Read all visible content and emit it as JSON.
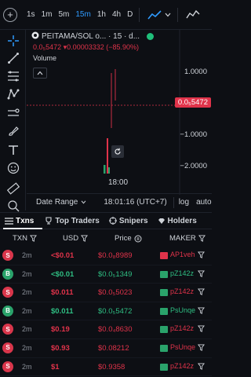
{
  "toolbar_top": {
    "timeframes": [
      "1s",
      "1m",
      "5m",
      "15m",
      "1h",
      "4h",
      "D"
    ],
    "active_timeframe": "15m"
  },
  "legend": {
    "pair_title": "PEITAMA/SOL o... · 15 · d...",
    "ohlc": "0.0₅5472 ▾0.00003332 (−85.90%)",
    "volume_label": "Volume"
  },
  "price_axis": {
    "labels": [
      "1.0000",
      "−1.0000",
      "−2.0000"
    ],
    "current_price": "0.0₅5472"
  },
  "time_axis": {
    "label": "18:00"
  },
  "date_bar": {
    "date_range_label": "Date Range",
    "clock": "18:01:16 (UTC+7)",
    "log_label": "log",
    "auto_label": "auto"
  },
  "tabs": [
    {
      "label": "Txns"
    },
    {
      "label": "Top Traders"
    },
    {
      "label": "Snipers"
    },
    {
      "label": "Holders"
    }
  ],
  "table_header": {
    "txn": "TXN",
    "usd": "USD",
    "price": "Price",
    "maker": "MAKER"
  },
  "rows": [
    {
      "side": "S",
      "age": "2m",
      "usd": "<$0.01",
      "price": "$0.0₈8989",
      "maker": "AP1veh",
      "type": "sell"
    },
    {
      "side": "B",
      "age": "2m",
      "usd": "<$0.01",
      "price": "$0.0₅1349",
      "maker": "pZ142z",
      "type": "buy"
    },
    {
      "side": "S",
      "age": "2m",
      "usd": "$0.011",
      "price": "$0.0₅5023",
      "maker": "pZ142z",
      "type": "sell"
    },
    {
      "side": "B",
      "age": "2m",
      "usd": "$0.011",
      "price": "$0.0₅5472",
      "maker": "PsUnqe",
      "type": "buy"
    },
    {
      "side": "S",
      "age": "2m",
      "usd": "$0.19",
      "price": "$0.0₄8630",
      "maker": "pZ142z",
      "type": "sell"
    },
    {
      "side": "S",
      "age": "2m",
      "usd": "$0.93",
      "price": "$0.08212",
      "maker": "PsUnqe",
      "type": "sell"
    },
    {
      "side": "S",
      "age": "2m",
      "usd": "$1",
      "price": "$0.9358",
      "maker": "pZ142z",
      "type": "sell"
    }
  ],
  "colors": {
    "sell": "#d9364b",
    "buy": "#2aa36b",
    "active_accent": "#2f9bff"
  }
}
